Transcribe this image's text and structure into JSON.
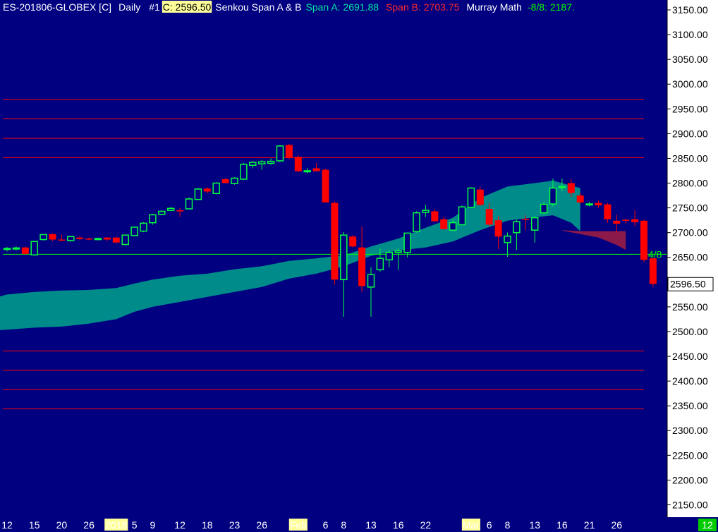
{
  "header": {
    "symbol": "ES-201806-GLOBEX [C]",
    "interval": "Daily",
    "instance": "#1",
    "close_label": "C: 2596.50",
    "study_name": "Senkou Span A & B",
    "span_a_label": "Span A: 2691.88",
    "span_b_label": "Span B: 2703.75",
    "murray_name": "Murray Math",
    "murray_value": "-8/8: 2187."
  },
  "colors": {
    "background": "#000080",
    "axis_panel": "#ffffff",
    "up_candle": "#00ff40",
    "down_candle": "#ff0000",
    "cloud_bull": "#008b8b",
    "cloud_bear": "#8b1a4a",
    "murray_line": "#ff0000",
    "midline": "#00ff00",
    "header_text": "#ffffff",
    "span_a_color": "#00e6a0",
    "span_b_color": "#ff2a2a",
    "murray_value_color": "#00ff00",
    "highlight": "#ffff99"
  },
  "chart_data": {
    "type": "candlestick",
    "ylim": [
      2125,
      3170
    ],
    "y_ticks": [
      3150,
      3100,
      3050,
      3000,
      2950,
      2900,
      2850,
      2800,
      2750,
      2700,
      2650,
      2600,
      2550,
      2500,
      2450,
      2400,
      2350,
      2300,
      2250,
      2200,
      2150
    ],
    "y_tick_labels": [
      "3150.00",
      "3100.00",
      "3050.00",
      "3000.00",
      "2950.00",
      "2900.00",
      "2850.00",
      "2800.00",
      "2750.00",
      "2700.00",
      "2650.00",
      "2600.00",
      "2550.00",
      "2500.00",
      "2450.00",
      "2400.00",
      "2350.00",
      "2300.00",
      "2250.00",
      "2200.00",
      "2150.00"
    ],
    "last_price": 2596.5,
    "last_price_label": "2596.50",
    "x_labels": [
      {
        "label": "12",
        "bar": 0,
        "highlight": false
      },
      {
        "label": "15",
        "bar": 3,
        "highlight": false
      },
      {
        "label": "20",
        "bar": 6,
        "highlight": false
      },
      {
        "label": "26",
        "bar": 9,
        "highlight": false
      },
      {
        "label": "2018",
        "bar": 12,
        "highlight": true
      },
      {
        "label": "5",
        "bar": 14,
        "highlight": false
      },
      {
        "label": "9",
        "bar": 16,
        "highlight": false
      },
      {
        "label": "12",
        "bar": 19,
        "highlight": false
      },
      {
        "label": "18",
        "bar": 22,
        "highlight": false
      },
      {
        "label": "23",
        "bar": 25,
        "highlight": false
      },
      {
        "label": "26",
        "bar": 28,
        "highlight": false
      },
      {
        "label": "Feb",
        "bar": 32,
        "highlight": true
      },
      {
        "label": "6",
        "bar": 35,
        "highlight": false
      },
      {
        "label": "8",
        "bar": 37,
        "highlight": false
      },
      {
        "label": "13",
        "bar": 40,
        "highlight": false
      },
      {
        "label": "16",
        "bar": 43,
        "highlight": false
      },
      {
        "label": "22",
        "bar": 46,
        "highlight": false
      },
      {
        "label": "Mar",
        "bar": 51,
        "highlight": true
      },
      {
        "label": "6",
        "bar": 53,
        "highlight": false
      },
      {
        "label": "8",
        "bar": 55,
        "highlight": false
      },
      {
        "label": "13",
        "bar": 58,
        "highlight": false
      },
      {
        "label": "16",
        "bar": 61,
        "highlight": false
      },
      {
        "label": "21",
        "bar": 64,
        "highlight": false
      },
      {
        "label": "26",
        "bar": 67,
        "highlight": false
      }
    ],
    "corner_label": "12",
    "candles": [
      {
        "o": 2667,
        "h": 2671,
        "l": 2662,
        "c": 2668
      },
      {
        "o": 2667,
        "h": 2672,
        "l": 2663,
        "c": 2669
      },
      {
        "o": 2670,
        "h": 2672,
        "l": 2655,
        "c": 2657
      },
      {
        "o": 2655,
        "h": 2683,
        "l": 2653,
        "c": 2682
      },
      {
        "o": 2686,
        "h": 2697,
        "l": 2684,
        "c": 2696
      },
      {
        "o": 2697,
        "h": 2698,
        "l": 2683,
        "c": 2686
      },
      {
        "o": 2686,
        "h": 2696,
        "l": 2682,
        "c": 2685
      },
      {
        "o": 2684,
        "h": 2693,
        "l": 2682,
        "c": 2692
      },
      {
        "o": 2690,
        "h": 2693,
        "l": 2685,
        "c": 2687
      },
      {
        "o": 2688,
        "h": 2690,
        "l": 2685,
        "c": 2687
      },
      {
        "o": 2687,
        "h": 2690,
        "l": 2685,
        "c": 2688
      },
      {
        "o": 2690,
        "h": 2691,
        "l": 2683,
        "c": 2686
      },
      {
        "o": 2690,
        "h": 2692,
        "l": 2678,
        "c": 2680
      },
      {
        "o": 2676,
        "h": 2696,
        "l": 2674,
        "c": 2695
      },
      {
        "o": 2694,
        "h": 2712,
        "l": 2693,
        "c": 2711
      },
      {
        "o": 2703,
        "h": 2721,
        "l": 2701,
        "c": 2719
      },
      {
        "o": 2720,
        "h": 2738,
        "l": 2716,
        "c": 2736
      },
      {
        "o": 2737,
        "h": 2745,
        "l": 2735,
        "c": 2743
      },
      {
        "o": 2745,
        "h": 2752,
        "l": 2743,
        "c": 2749
      },
      {
        "o": 2745,
        "h": 2750,
        "l": 2732,
        "c": 2744
      },
      {
        "o": 2748,
        "h": 2771,
        "l": 2747,
        "c": 2768
      },
      {
        "o": 2767,
        "h": 2790,
        "l": 2766,
        "c": 2788
      },
      {
        "o": 2789,
        "h": 2792,
        "l": 2779,
        "c": 2783
      },
      {
        "o": 2779,
        "h": 2802,
        "l": 2777,
        "c": 2800
      },
      {
        "o": 2808,
        "h": 2810,
        "l": 2800,
        "c": 2800
      },
      {
        "o": 2799,
        "h": 2812,
        "l": 2797,
        "c": 2810
      },
      {
        "o": 2808,
        "h": 2841,
        "l": 2806,
        "c": 2838
      },
      {
        "o": 2836,
        "h": 2844,
        "l": 2830,
        "c": 2842
      },
      {
        "o": 2839,
        "h": 2847,
        "l": 2827,
        "c": 2843
      },
      {
        "o": 2840,
        "h": 2850,
        "l": 2837,
        "c": 2844
      },
      {
        "o": 2845,
        "h": 2877,
        "l": 2843,
        "c": 2875
      },
      {
        "o": 2877,
        "h": 2879,
        "l": 2848,
        "c": 2851
      },
      {
        "o": 2853,
        "h": 2856,
        "l": 2822,
        "c": 2824
      },
      {
        "o": 2825,
        "h": 2830,
        "l": 2820,
        "c": 2825
      },
      {
        "o": 2830,
        "h": 2841,
        "l": 2825,
        "c": 2824
      },
      {
        "o": 2827,
        "h": 2829,
        "l": 2761,
        "c": 2761
      },
      {
        "o": 2760,
        "h": 2763,
        "l": 2595,
        "c": 2605
      },
      {
        "o": 2605,
        "h": 2701,
        "l": 2530,
        "c": 2695
      },
      {
        "o": 2692,
        "h": 2695,
        "l": 2670,
        "c": 2672
      },
      {
        "o": 2670,
        "h": 2713,
        "l": 2580,
        "c": 2592
      },
      {
        "o": 2590,
        "h": 2630,
        "l": 2530,
        "c": 2615
      },
      {
        "o": 2625,
        "h": 2668,
        "l": 2621,
        "c": 2648
      },
      {
        "o": 2645,
        "h": 2665,
        "l": 2630,
        "c": 2660
      },
      {
        "o": 2660,
        "h": 2668,
        "l": 2625,
        "c": 2663
      },
      {
        "o": 2660,
        "h": 2700,
        "l": 2650,
        "c": 2699
      },
      {
        "o": 2702,
        "h": 2743,
        "l": 2700,
        "c": 2740
      },
      {
        "o": 2741,
        "h": 2756,
        "l": 2732,
        "c": 2745
      },
      {
        "o": 2743,
        "h": 2748,
        "l": 2722,
        "c": 2723
      },
      {
        "o": 2727,
        "h": 2733,
        "l": 2712,
        "c": 2707
      },
      {
        "o": 2705,
        "h": 2726,
        "l": 2703,
        "c": 2720
      },
      {
        "o": 2716,
        "h": 2755,
        "l": 2716,
        "c": 2752
      },
      {
        "o": 2751,
        "h": 2792,
        "l": 2750,
        "c": 2790
      },
      {
        "o": 2787,
        "h": 2792,
        "l": 2754,
        "c": 2756
      },
      {
        "o": 2748,
        "h": 2760,
        "l": 2713,
        "c": 2716
      },
      {
        "o": 2725,
        "h": 2733,
        "l": 2667,
        "c": 2692
      },
      {
        "o": 2680,
        "h": 2700,
        "l": 2651,
        "c": 2693
      },
      {
        "o": 2700,
        "h": 2726,
        "l": 2665,
        "c": 2722
      },
      {
        "o": 2728,
        "h": 2735,
        "l": 2705,
        "c": 2727
      },
      {
        "o": 2705,
        "h": 2733,
        "l": 2680,
        "c": 2730
      },
      {
        "o": 2740,
        "h": 2762,
        "l": 2738,
        "c": 2757
      },
      {
        "o": 2758,
        "h": 2809,
        "l": 2753,
        "c": 2790
      },
      {
        "o": 2791,
        "h": 2809,
        "l": 2784,
        "c": 2793
      },
      {
        "o": 2800,
        "h": 2808,
        "l": 2772,
        "c": 2780
      },
      {
        "o": 2775,
        "h": 2780,
        "l": 2758,
        "c": 2761
      },
      {
        "o": 2756,
        "h": 2762,
        "l": 2753,
        "c": 2758
      },
      {
        "o": 2760,
        "h": 2765,
        "l": 2750,
        "c": 2755
      },
      {
        "o": 2757,
        "h": 2760,
        "l": 2720,
        "c": 2727
      },
      {
        "o": 2724,
        "h": 2736,
        "l": 2700,
        "c": 2718
      },
      {
        "o": 2726,
        "h": 2728,
        "l": 2718,
        "c": 2725
      },
      {
        "o": 2727,
        "h": 2745,
        "l": 2713,
        "c": 2721
      },
      {
        "o": 2724,
        "h": 2726,
        "l": 2640,
        "c": 2645
      },
      {
        "o": 2648,
        "h": 2649,
        "l": 2590,
        "c": 2596.5
      }
    ],
    "cloud": {
      "x_bars": [
        -4,
        0,
        3,
        6,
        9,
        12,
        14,
        16,
        19,
        22,
        25,
        28,
        31,
        34,
        37,
        40,
        43,
        46,
        49,
        52,
        55,
        58,
        60,
        62,
        63
      ],
      "upper": [
        2555,
        2575,
        2580,
        2583,
        2584,
        2588,
        2597,
        2605,
        2613,
        2617,
        2626,
        2632,
        2643,
        2648,
        2654,
        2672,
        2688,
        2710,
        2730,
        2770,
        2793,
        2800,
        2805,
        2795,
        2790
      ],
      "lower": [
        2500,
        2504,
        2508,
        2510,
        2516,
        2525,
        2540,
        2550,
        2560,
        2570,
        2580,
        2590,
        2607,
        2617,
        2632,
        2653,
        2664,
        2670,
        2682,
        2705,
        2724,
        2731,
        2735,
        2720,
        2703
      ],
      "bear_x_bars": [
        61,
        63,
        65,
        67,
        68
      ],
      "bear_upper": [
        2705,
        2703,
        2703,
        2703,
        2703
      ],
      "bear_lower": [
        2704,
        2697,
        2690,
        2675,
        2665
      ]
    },
    "murray_lines": [
      2968.75,
      2929.69,
      2890.63,
      2851.56,
      2460.94,
      2421.88,
      2382.81,
      2343.75
    ],
    "midline": 2656.25,
    "midline_label": "4/8"
  }
}
